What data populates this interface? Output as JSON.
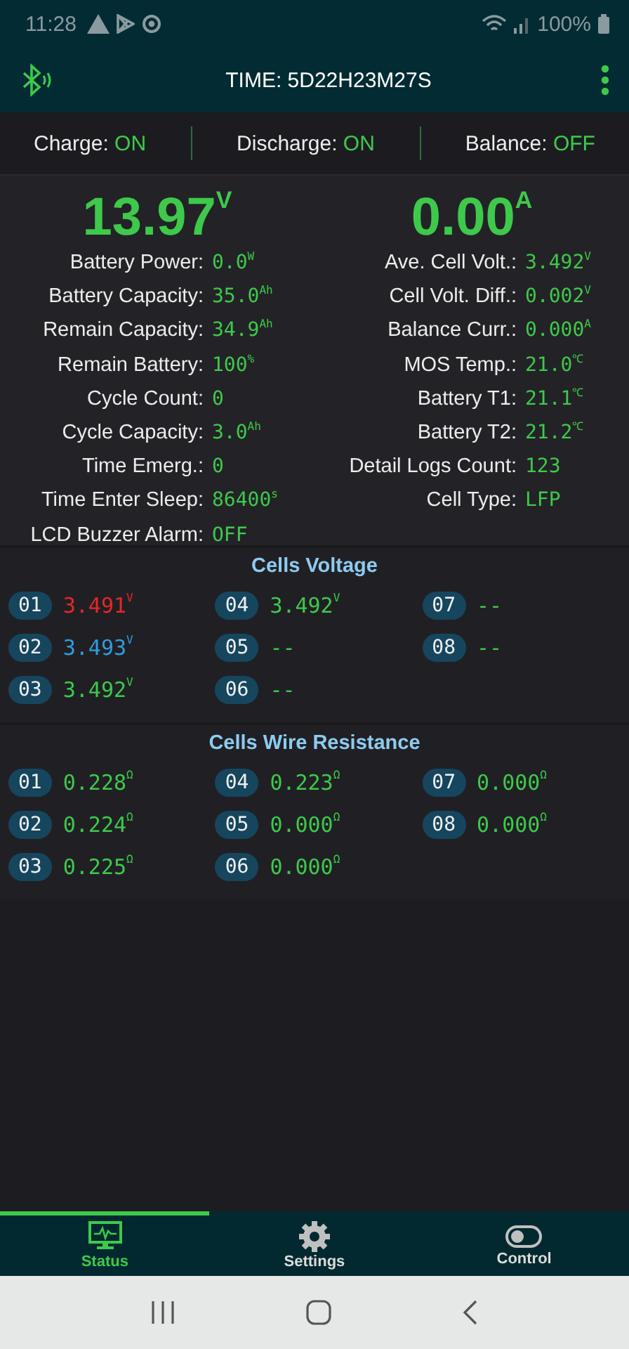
{
  "status_bar": {
    "time": "11:28",
    "battery": "100%"
  },
  "app_bar": {
    "title": "TIME: 5D22H23M27S"
  },
  "switches": [
    {
      "label": "Charge:",
      "value": "ON"
    },
    {
      "label": "Discharge:",
      "value": "ON"
    },
    {
      "label": "Balance:",
      "value": "OFF"
    }
  ],
  "main_readings": [
    {
      "value": "13.97",
      "unit": "V"
    },
    {
      "value": "0.00",
      "unit": "A"
    }
  ],
  "left_stats": [
    {
      "label": "Battery Power:",
      "value": "0.0",
      "unit": "W"
    },
    {
      "label": "Battery Capacity:",
      "value": "35.0",
      "unit": "Ah"
    },
    {
      "label": "Remain Capacity:",
      "value": "34.9",
      "unit": "Ah"
    },
    {
      "label": "Remain Battery:",
      "value": "100",
      "unit": "%"
    },
    {
      "label": "Cycle Count:",
      "value": "0"
    },
    {
      "label": "Cycle Capacity:",
      "value": "3.0",
      "unit": "Ah"
    },
    {
      "label": "Time Emerg.:",
      "value": "0"
    },
    {
      "label": "Time Enter Sleep:",
      "value": "86400",
      "unit": "s"
    },
    {
      "label": "LCD Buzzer Alarm:",
      "value": "OFF"
    }
  ],
  "right_stats": [
    {
      "label": "Ave. Cell Volt.:",
      "value": "3.492",
      "unit": "V"
    },
    {
      "label": "Cell Volt. Diff.:",
      "value": "0.002",
      "unit": "V"
    },
    {
      "label": "Balance Curr.:",
      "value": "0.000",
      "unit": "A"
    },
    {
      "label": "MOS Temp.:",
      "value": "21.0",
      "unit": "℃"
    },
    {
      "label": "Battery T1:",
      "value": "21.1",
      "unit": "℃"
    },
    {
      "label": "Battery T2:",
      "value": "21.2",
      "unit": "℃"
    },
    {
      "label": "Detail Logs Count:",
      "value": "123"
    },
    {
      "label": "Cell Type:",
      "value": "LFP"
    }
  ],
  "cells_voltage": {
    "title": "Cells Voltage",
    "cells": [
      {
        "index": "01",
        "value": "3.491",
        "unit": "V",
        "color": "#e8262a"
      },
      {
        "index": "02",
        "value": "3.493",
        "unit": "V",
        "color": "#2f9de0"
      },
      {
        "index": "03",
        "value": "3.492",
        "unit": "V",
        "color": "#3ec94b"
      },
      {
        "index": "04",
        "value": "3.492",
        "unit": "V",
        "color": "#3ec94b"
      },
      {
        "index": "05",
        "value": "--",
        "color": "#3ec94b"
      },
      {
        "index": "06",
        "value": "--",
        "color": "#3ec94b"
      },
      {
        "index": "07",
        "value": "--",
        "color": "#3ec94b"
      },
      {
        "index": "08",
        "value": "--",
        "color": "#3ec94b"
      }
    ]
  },
  "cells_resistance": {
    "title": "Cells Wire Resistance",
    "cells": [
      {
        "index": "01",
        "value": "0.228",
        "unit": "Ω",
        "color": "#3ec94b"
      },
      {
        "index": "02",
        "value": "0.224",
        "unit": "Ω",
        "color": "#3ec94b"
      },
      {
        "index": "03",
        "value": "0.225",
        "unit": "Ω",
        "color": "#3ec94b"
      },
      {
        "index": "04",
        "value": "0.223",
        "unit": "Ω",
        "color": "#3ec94b"
      },
      {
        "index": "05",
        "value": "0.000",
        "unit": "Ω",
        "color": "#3ec94b"
      },
      {
        "index": "06",
        "value": "0.000",
        "unit": "Ω",
        "color": "#3ec94b"
      },
      {
        "index": "07",
        "value": "0.000",
        "unit": "Ω",
        "color": "#3ec94b"
      },
      {
        "index": "08",
        "value": "0.000",
        "unit": "Ω",
        "color": "#3ec94b"
      }
    ]
  },
  "tabs": [
    {
      "label": "Status",
      "kind": "status",
      "selected": true
    },
    {
      "label": "Settings",
      "kind": "settings",
      "selected": false
    },
    {
      "label": "Control",
      "kind": "control",
      "selected": false
    }
  ]
}
